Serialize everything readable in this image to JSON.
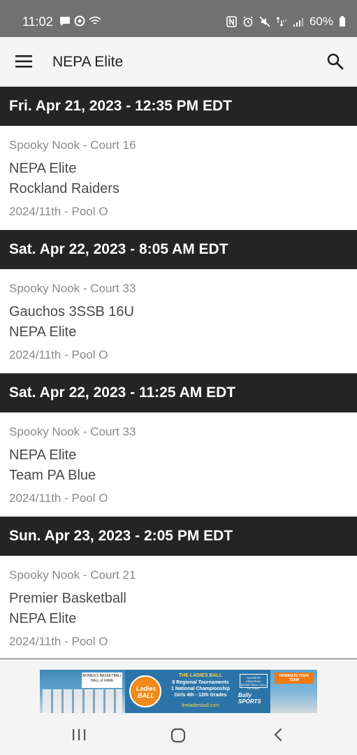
{
  "status_bar": {
    "time": "11:02",
    "battery": "60%",
    "left_icons": [
      "chat-bubble-icon",
      "target-icon",
      "wifi-icon"
    ],
    "right_icons": [
      "nfc-icon",
      "alarm-icon",
      "mute-icon",
      "lte-icon",
      "signal-icon",
      "battery-icon"
    ]
  },
  "app_bar": {
    "title": "NEPA Elite",
    "menu_icon": "hamburger-menu-icon",
    "search_icon": "search-icon"
  },
  "games": [
    {
      "datetime": "Fri. Apr 21, 2023 - 12:35 PM EDT",
      "venue": "Spooky Nook - Court 16",
      "team1": "NEPA Elite",
      "team2": "Rockland Raiders",
      "division": "2024/11th - Pool O"
    },
    {
      "datetime": "Sat. Apr 22, 2023 - 8:05 AM EDT",
      "venue": "Spooky Nook - Court 33",
      "team1": "Gauchos 3SSB 16U",
      "team2": "NEPA Elite",
      "division": "2024/11th - Pool O"
    },
    {
      "datetime": "Sat. Apr 22, 2023 - 11:25 AM EDT",
      "venue": "Spooky Nook - Court 33",
      "team1": "NEPA Elite",
      "team2": "Team PA Blue",
      "division": "2024/11th - Pool O"
    },
    {
      "datetime": "Sun. Apr 23, 2023 - 2:05 PM EDT",
      "venue": "Spooky Nook - Court 21",
      "team1": "Premier Basketball",
      "team2": "NEPA Elite",
      "division": "2024/11th - Pool O"
    }
  ],
  "ad": {
    "logo_text": "WOMEN'S BASKETBALL HALL of FAME",
    "ball_text": "Ladies BALL",
    "headline": "THE LADIES BALL",
    "line1": "8 Regional Tournaments",
    "line2": "1 National Championship",
    "line3": "Girls 4th - 12th Grades",
    "sports": "Bally SPORTS",
    "url": "theladiesball.com",
    "hof_text": "NAISMITH MEMORIAL BASKETBALL HALL OF FAME",
    "nominate": "NOMINATE YOUR TEAM"
  },
  "nav_bar": {
    "icons": [
      "recents-icon",
      "home-icon",
      "back-icon"
    ]
  },
  "colors": {
    "status_bar": "#717171",
    "app_bar": "#f5f5f5",
    "date_header": "#242424",
    "ad_accent": "#f08a1a"
  }
}
